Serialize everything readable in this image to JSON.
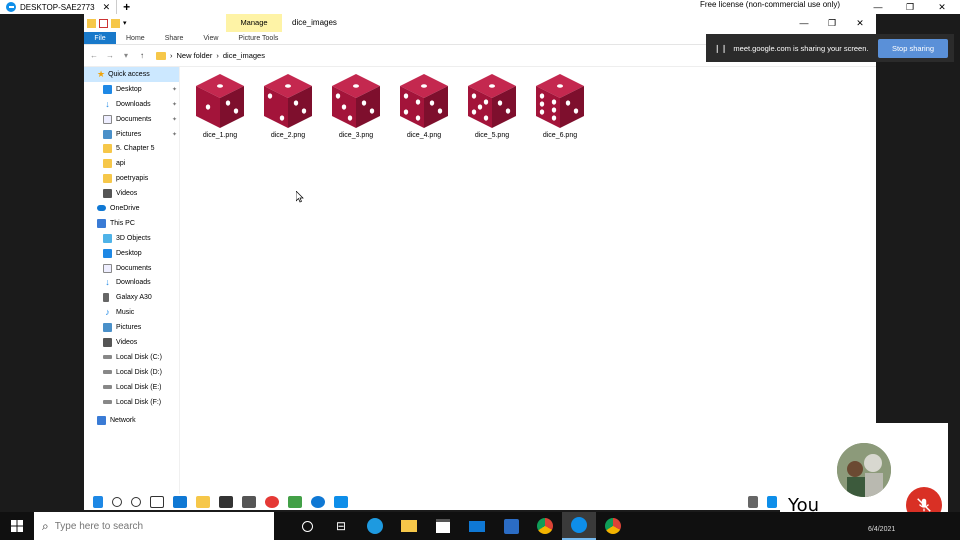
{
  "teamviewer": {
    "tab_title": "DESKTOP-SAE2773",
    "license_text": "Free license (non-commercial use only)"
  },
  "explorer": {
    "manage_label": "Manage",
    "folder_title": "dice_images",
    "ribbon": {
      "file": "File",
      "tabs": [
        "Home",
        "Share",
        "View",
        "Picture Tools"
      ]
    },
    "breadcrumb": [
      "New folder",
      "dice_images"
    ],
    "nav": {
      "quick_access": "Quick access",
      "quick_items": [
        "Desktop",
        "Downloads",
        "Documents",
        "Pictures",
        "5. Chapter 5",
        "api",
        "poetryapis",
        "Videos"
      ],
      "onedrive": "OneDrive",
      "this_pc": "This PC",
      "pc_items": [
        "3D Objects",
        "Desktop",
        "Documents",
        "Downloads",
        "Galaxy A30",
        "Music",
        "Pictures",
        "Videos",
        "Local Disk (C:)",
        "Local Disk (D:)",
        "Local Disk (E:)",
        "Local Disk (F:)"
      ],
      "network": "Network"
    },
    "files": [
      {
        "name": "dice_1.png",
        "pips": 1
      },
      {
        "name": "dice_2.png",
        "pips": 2
      },
      {
        "name": "dice_3.png",
        "pips": 3
      },
      {
        "name": "dice_4.png",
        "pips": 4
      },
      {
        "name": "dice_5.png",
        "pips": 5
      },
      {
        "name": "dice_6.png",
        "pips": 6
      }
    ]
  },
  "meet": {
    "sharing_text": "meet.google.com is sharing your screen.",
    "stop_label": "Stop sharing"
  },
  "selfview": {
    "label": "You"
  },
  "taskbar": {
    "search_placeholder": "Type here to search",
    "date": "6/4/2021"
  },
  "colors": {
    "dice": "#a3143a",
    "stop_button": "#5a90d8",
    "mic_off": "#d93025",
    "file_tab": "#1979ca",
    "manage_bg": "#fef3a6"
  }
}
